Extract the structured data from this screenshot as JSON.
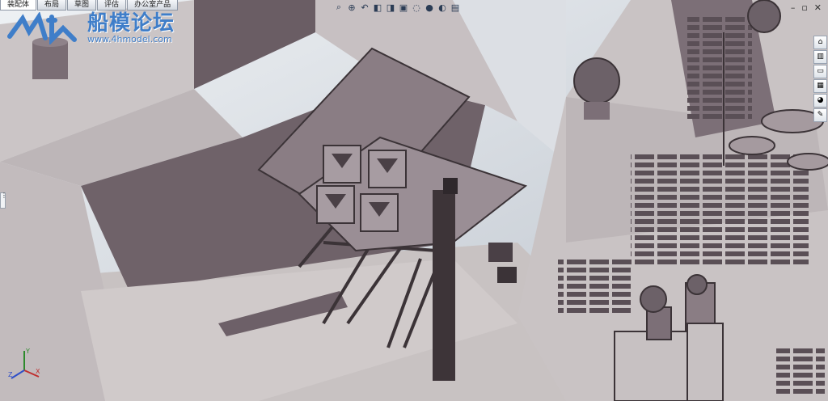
{
  "tabs": [
    {
      "label": "装配体",
      "active": true
    },
    {
      "label": "布局",
      "active": false
    },
    {
      "label": "草图",
      "active": false
    },
    {
      "label": "评估",
      "active": false
    },
    {
      "label": "办公室产品",
      "active": false
    }
  ],
  "watermark": {
    "title": "船模论坛",
    "url": "www.4hmodel.com",
    "color": "#3f7ec9"
  },
  "heads_up_toolbar": {
    "icons": [
      "zoom-to-fit-icon",
      "zoom-area-icon",
      "previous-view-icon",
      "section-view-icon",
      "view-orientation-icon",
      "display-style-icon",
      "hide-show-icon",
      "edit-appearance-icon",
      "apply-scene-icon",
      "view-settings-icon"
    ]
  },
  "window_controls": {
    "minimize": "–",
    "restore": "▫",
    "close": "✕"
  },
  "task_pane": {
    "icons": [
      "solidworks-resources-icon",
      "design-library-icon",
      "file-explorer-icon",
      "view-palette-icon",
      "appearances-icon",
      "custom-properties-icon"
    ]
  },
  "triad": {
    "x": "X",
    "y": "Y",
    "z": "Z"
  },
  "colors": {
    "hull": "#c9c2c2",
    "hull_dark": "#6e6068",
    "sky": "#d9dde4",
    "launcher": "#8a7d84",
    "accent": "#3f7ec9"
  }
}
